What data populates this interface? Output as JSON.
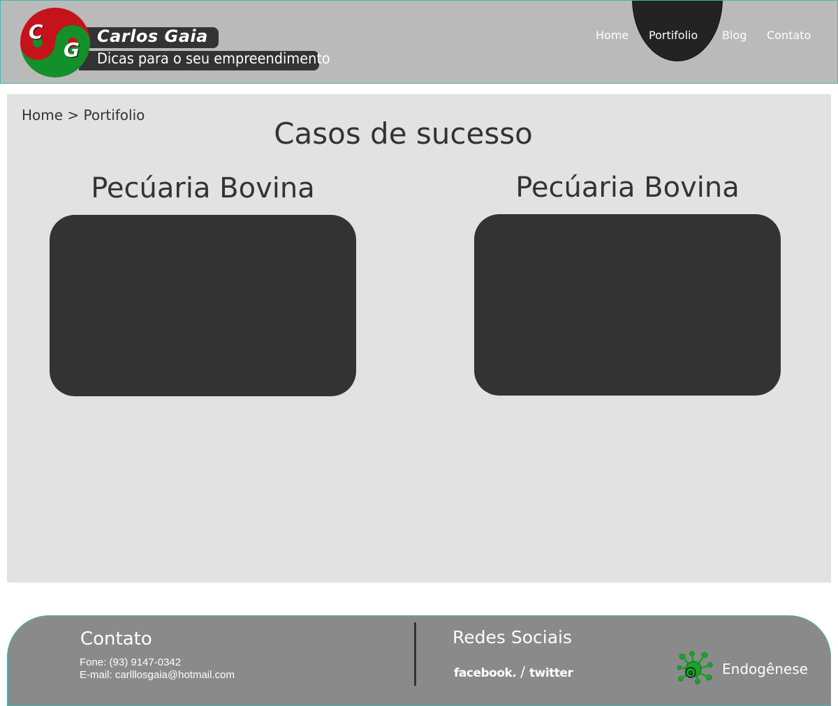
{
  "brand": {
    "logo_letter_c": "C",
    "logo_letter_g": "G",
    "name": "Carlos Gaia",
    "tagline": "Dicas para o seu empreendimento",
    "colors": {
      "red": "#c4131a",
      "green": "#14902a",
      "bar": "#333333"
    }
  },
  "nav": {
    "items": [
      {
        "label": "Home"
      },
      {
        "label": "Portifolio",
        "active": true
      },
      {
        "label": "Blog"
      },
      {
        "label": "Contato"
      }
    ]
  },
  "breadcrumb": {
    "home": "Home",
    "separator": ">",
    "current": "Portifolio"
  },
  "main": {
    "title": "Casos de sucesso",
    "cases": [
      {
        "title": "Pecúaria Bovina"
      },
      {
        "title": "Pecúaria Bovina"
      }
    ]
  },
  "footer": {
    "contact_heading": "Contato",
    "phone": "Fone: (93) 9147-0342",
    "email": "E-mail: carlllosgaia@hotmail.com",
    "social_heading": "Redes Sociais",
    "facebook": "facebook.",
    "social_separator": "/",
    "twitter": "twitter",
    "credit": "Endogênese",
    "credit_icon": "endogenese-logo-icon"
  },
  "theme": {
    "header_bg": "#bababa",
    "header_border": "#3fb8b0",
    "main_bg": "#e2e2e2",
    "card_bg": "#333333",
    "footer_bg": "#8a8a8a",
    "nav_active_bg": "#232323"
  }
}
